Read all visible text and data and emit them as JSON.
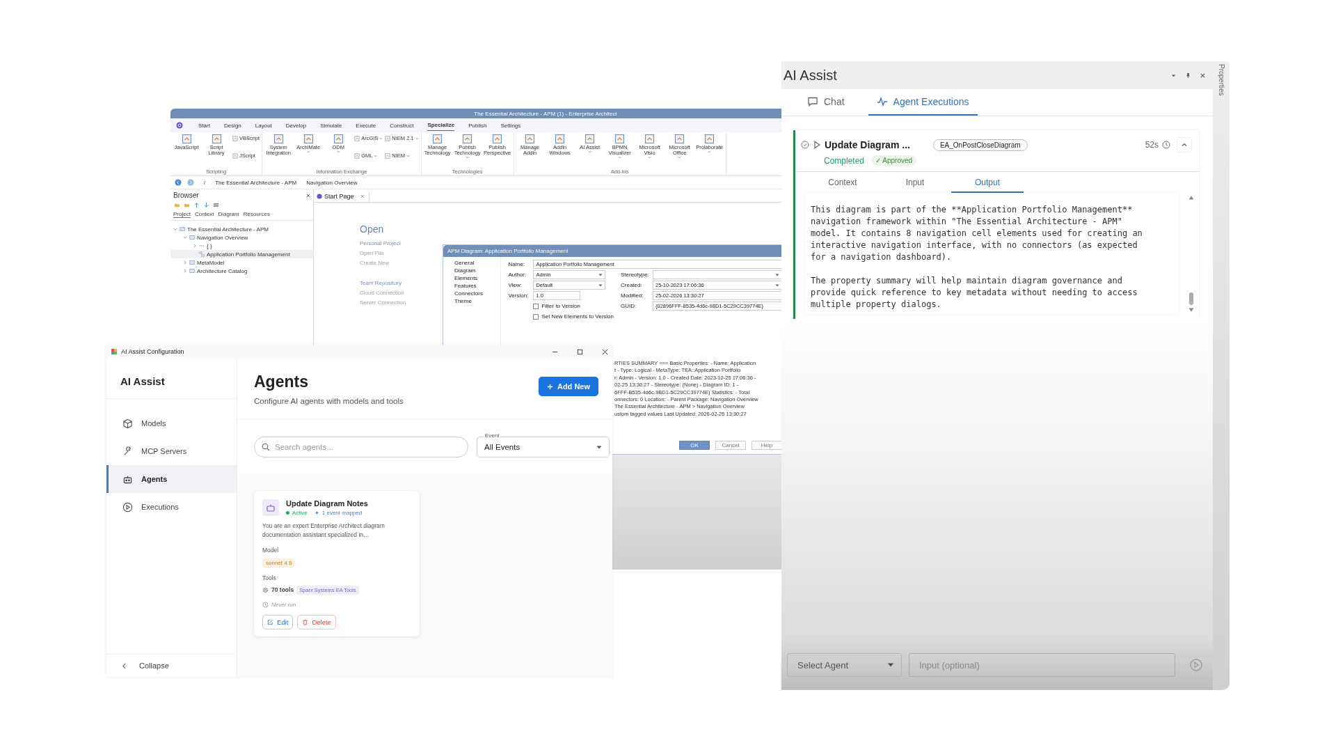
{
  "ea_window": {
    "title": "The Essential Architecture - APM (1) - Enterprise Architect",
    "menu_tabs": [
      {
        "label": "Start",
        "selected": false
      },
      {
        "label": "Design",
        "selected": false
      },
      {
        "label": "Layout",
        "selected": false
      },
      {
        "label": "Develop",
        "selected": false
      },
      {
        "label": "Simulate",
        "selected": false
      },
      {
        "label": "Execute",
        "selected": false
      },
      {
        "label": "Construct",
        "selected": false
      },
      {
        "label": "Specialize",
        "selected": true
      },
      {
        "label": "Publish",
        "selected": false
      },
      {
        "label": "Settings",
        "selected": false
      }
    ],
    "ribbon_groups": [
      {
        "name": "Scripting",
        "buttons": [
          {
            "label": "JavaScript",
            "kind": "large",
            "menu": false
          },
          {
            "label": "Script Library",
            "kind": "large",
            "menu": false
          },
          {
            "label": "VBScript",
            "kind": "small",
            "menu": false
          },
          {
            "label": "JScript",
            "kind": "small",
            "menu": false
          }
        ]
      },
      {
        "name": "Information Exchange",
        "buttons": [
          {
            "label": "System Integration",
            "kind": "large",
            "menu": false
          },
          {
            "label": "ArchiMate",
            "kind": "large",
            "menu": true
          },
          {
            "label": "ODM",
            "kind": "large",
            "menu": true
          },
          {
            "label": "ArcGIS",
            "kind": "small",
            "menu": true
          },
          {
            "label": "GML",
            "kind": "small",
            "menu": true
          },
          {
            "label": "NIEM 2.1",
            "kind": "small",
            "menu": true
          },
          {
            "label": "NIEM",
            "kind": "small",
            "menu": true
          }
        ]
      },
      {
        "name": "Technologies",
        "buttons": [
          {
            "label": "Manage Technology",
            "kind": "large",
            "menu": false
          },
          {
            "label": "Publish Technology",
            "kind": "large",
            "menu": true
          },
          {
            "label": "Publish Perspective",
            "kind": "large",
            "menu": false
          }
        ]
      },
      {
        "name": "Add-Ins",
        "buttons": [
          {
            "label": "Manage Addin",
            "kind": "large",
            "menu": false
          },
          {
            "label": "Addin Windows",
            "kind": "large",
            "menu": false
          },
          {
            "label": "AI Assist",
            "kind": "large",
            "menu": true
          },
          {
            "label": "BPMN Visualizer",
            "kind": "large",
            "menu": true
          },
          {
            "label": "Microsoft Visio",
            "kind": "large",
            "menu": true
          },
          {
            "label": "Microsoft Office",
            "kind": "large",
            "menu": true
          },
          {
            "label": "Prolaborate",
            "kind": "large",
            "menu": true
          }
        ]
      }
    ],
    "breadcrumb": [
      "/",
      "The Essential Architecture - APM",
      "Navigation Overview"
    ],
    "browser": {
      "title": "Browser",
      "tabs": [
        {
          "label": "Project",
          "selected": true
        },
        {
          "label": "Context",
          "selected": false
        },
        {
          "label": "Diagram",
          "selected": false
        },
        {
          "label": "Resources",
          "selected": false
        }
      ],
      "tree": [
        {
          "label": "The Essential Architecture - APM",
          "kind": "model",
          "expanded": true,
          "selected": false,
          "children": [
            {
              "label": "Navigation Overview",
              "kind": "package",
              "expanded": true,
              "selected": false,
              "children": [
                {
                  "label": "{ }",
                  "kind": "element",
                  "expanded": false,
                  "selected": false
                },
                {
                  "label": "Application Portfolio Management",
                  "kind": "diagram",
                  "selected": true
                }
              ]
            },
            {
              "label": "MetaModel",
              "kind": "package",
              "expanded": false,
              "selected": false
            },
            {
              "label": "Architecture Catalog",
              "kind": "package",
              "expanded": false,
              "selected": false
            }
          ]
        }
      ]
    },
    "document_tab": "Start Page",
    "start_page": {
      "heading": "Open",
      "links": [
        "Personal Project",
        "Open File",
        "Create New"
      ],
      "team_heading": "Team Repository",
      "team_links": [
        "Cloud Connection",
        "Server Connection"
      ]
    },
    "dialog": {
      "title": "APM Diagram: Application Portfolio Management",
      "pages": [
        "General",
        "Diagram",
        "Elements",
        "Features",
        "Connectors",
        "Theme"
      ],
      "name_field": {
        "label": "Name:",
        "value": "Application Portfolio Management"
      },
      "left_fields": [
        {
          "label": "Author:",
          "value": "Admin",
          "kind": "select"
        },
        {
          "label": "View:",
          "value": "Default",
          "kind": "select"
        },
        {
          "label": "Version:",
          "value": "1.0",
          "kind": "text"
        }
      ],
      "right_fields": [
        {
          "label": "Stereotype:",
          "kind": "select"
        },
        {
          "label": "Created:",
          "value": "25-10-2023 17:06:36",
          "kind": "select"
        },
        {
          "label": "Modified:",
          "value": "25-02-2026 13:30:27",
          "kind": "text"
        },
        {
          "label": "GUID:",
          "value": "{02896FFF-8535-4d6c-98D1-5C29CC39774E}",
          "kind": "text"
        }
      ],
      "checkboxes": [
        {
          "label": "Filter to Version",
          "checked": false
        },
        {
          "label": "Set New Elements to Version",
          "checked": false
        }
      ],
      "notes_lines": [
        "RTIES SUMMARY === Basic Properties: - Name: Application",
        "t - Type: Logical - MetaType: TEA::Application Portfolio",
        "r: Admin - Version: 1.0 - Created Date: 2023-10-25 17:06:36 -",
        "02-25 13:30:27 - Stereotype: (None) - Diagram ID: 1 -",
        "6FFF-B535-4d6c-9BD1-5C29CC39774E) Statistics: - Total",
        "onnectors: 0 Location: - Parent Package: Navigation Overview",
        "The Essential Architecture - APM > Navigation Overview",
        "ustom tagged values Last Updated: 2026-02-25 13:30:27"
      ],
      "buttons": [
        {
          "label": "OK",
          "default": true
        },
        {
          "label": "Cancel",
          "default": false
        },
        {
          "label": "Help",
          "default": false
        }
      ]
    }
  },
  "config_window": {
    "title": "AI Assist Configuration",
    "sidebar": {
      "title": "AI Assist",
      "items": [
        {
          "label": "Models",
          "kind": "models",
          "selected": false
        },
        {
          "label": "MCP Servers",
          "kind": "servers",
          "selected": false
        },
        {
          "label": "Agents",
          "kind": "agents",
          "selected": true
        },
        {
          "label": "Executions",
          "kind": "executions",
          "selected": false
        }
      ],
      "collapse": "Collapse"
    },
    "heading": "Agents",
    "subtitle": "Configure AI agents with models and tools",
    "add_button": "Add New",
    "search": {
      "placeholder": "Search agents..."
    },
    "event_filter": {
      "label": "Event",
      "value": "All Events"
    },
    "agents": [
      {
        "name": "Update Diagram Notes",
        "active": true,
        "status": "Active",
        "events": "1 event mapped",
        "description": "You are an expert Enterprise Architect diagram documentation assistant specialized in…",
        "model_label": "Model",
        "model": "sonnet 4.5",
        "tools_label": "Tools",
        "tools_count": "70 tools",
        "tool_tag": "Sparx Systems EA Tools",
        "last_run": "Never run",
        "edit": "Edit",
        "delete": "Delete"
      }
    ]
  },
  "ai_panel": {
    "title": "AI Assist",
    "side_tab": "Properties",
    "tabs": [
      {
        "label": "Chat",
        "kind": "chat",
        "selected": false
      },
      {
        "label": "Agent Executions",
        "kind": "executions",
        "selected": true
      }
    ],
    "executions": [
      {
        "name": "Update Diagram ...",
        "event": "EA_OnPostCloseDiagram",
        "duration": "52s",
        "expanded": true,
        "status": "Completed",
        "approval": "✓ Approved",
        "tabs": [
          {
            "label": "Context",
            "selected": false
          },
          {
            "label": "Input",
            "selected": false
          },
          {
            "label": "Output",
            "selected": true
          }
        ],
        "output": [
          "This diagram is part of the **Application Portfolio Management** navigation framework within \"The Essential Architecture - APM\" model. It contains 8 navigation cell elements used for creating an interactive navigation interface, with no connectors (as expected for a navigation dashboard).",
          "The property summary will help maintain diagram governance and provide quick reference to key metadata without needing to access multiple property dialogs."
        ]
      }
    ],
    "agent_select": {
      "value": "Select Agent"
    },
    "input": {
      "placeholder": "Input (optional)"
    }
  }
}
